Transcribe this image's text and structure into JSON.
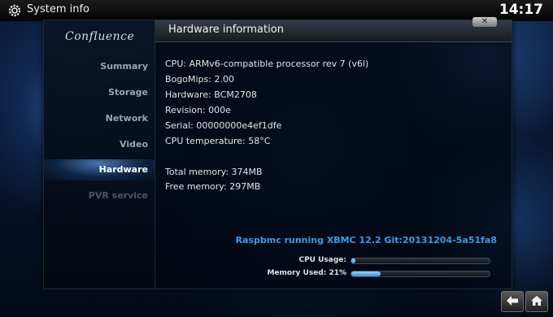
{
  "topbar": {
    "title": "System info",
    "clock": "14:17",
    "icon": "gear-icon"
  },
  "skin": {
    "logo": "Confluence"
  },
  "sidebar": {
    "items": [
      {
        "label": "Summary"
      },
      {
        "label": "Storage"
      },
      {
        "label": "Network"
      },
      {
        "label": "Video"
      },
      {
        "label": "Hardware",
        "active": true
      },
      {
        "label": "PVR service",
        "disabled": true
      }
    ]
  },
  "content": {
    "title": "Hardware information",
    "close_icon": "close-icon",
    "lines": [
      "CPU: ARMv6-compatible processor rev 7 (v6l)",
      "BogoMips: 2.00",
      "Hardware: BCM2708",
      "Revision: 000e",
      "Serial: 00000000e4ef1dfe",
      "CPU temperature: 58°C",
      "Total memory: 374MB",
      "Free memory: 297MB"
    ],
    "status": "Raspbmc running XBMC 12.2 Git:20131204-5a51fa8",
    "meters": [
      {
        "label": "CPU Usage:",
        "value": 0.02
      },
      {
        "label": "Memory Used: 21%",
        "value": 0.21
      }
    ]
  },
  "colors": {
    "accent": "#3a9ce8",
    "meter_fill": "#3a8fe0"
  },
  "bottom_buttons": [
    {
      "icon": "back-arrow-icon"
    },
    {
      "icon": "home-icon"
    }
  ]
}
